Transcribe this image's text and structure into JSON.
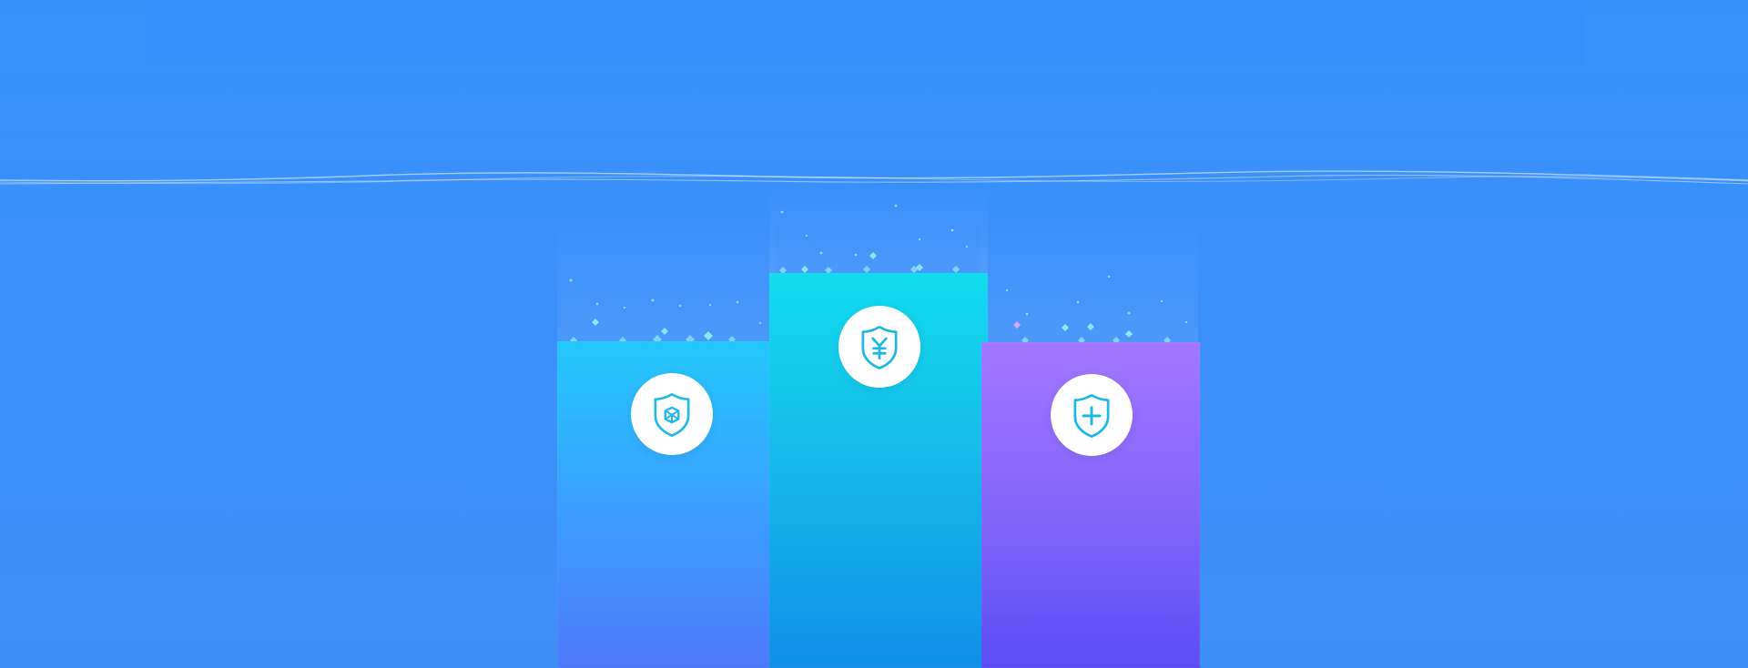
{
  "scene": {
    "background_color": "#3592fd",
    "accent_colors": {
      "left": "#22c8fd",
      "center": "#10dcef",
      "right": "#a276ff"
    }
  },
  "pillars": [
    {
      "icon": "shield-cube-icon"
    },
    {
      "icon": "shield-yen-icon"
    },
    {
      "icon": "shield-plus-icon"
    }
  ]
}
